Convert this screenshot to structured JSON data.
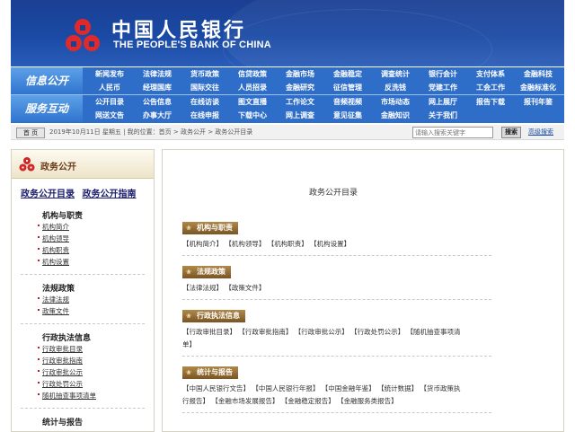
{
  "header": {
    "bank_cn": "中国人民银行",
    "bank_en": "THE PEOPLE'S BANK OF CHINA"
  },
  "nav": {
    "row1": {
      "label": "信息公开",
      "items": [
        "新闻发布",
        "法律法规",
        "货币政策",
        "信贷政策",
        "金融市场",
        "金融稳定",
        "调查统计",
        "银行会计",
        "支付体系",
        "金融科技",
        "人民币",
        "经理国库",
        "国际交往",
        "人员招录",
        "金融研究",
        "征信管理",
        "反洗钱",
        "党建工作",
        "工会工作",
        "金融标准化"
      ]
    },
    "row2": {
      "label": "服务互动",
      "items": [
        "公开目录",
        "公告信息",
        "在线访谈",
        "图文直播",
        "工作论文",
        "音频视频",
        "市场动态",
        "网上展厅",
        "报告下载",
        "报刊年鉴",
        "网送文告",
        "办事大厅",
        "在线申报",
        "下载中心",
        "网上调查",
        "意见征集",
        "金融知识",
        "关于我们"
      ]
    }
  },
  "crumb": {
    "home_label": "首 页",
    "text": "2019年10月11日  星期五  | 我的位置：首页 > 政务公开 > 政务公开目录",
    "search_placeholder": "请输入搜索关键字",
    "search_label": "搜索",
    "advanced_label": "高级搜索"
  },
  "sidebar": {
    "title": "政务公开",
    "link1": "政务公开目录",
    "link2": "政务公开指南",
    "sections": [
      {
        "title": "机构与职责",
        "items": [
          "机构简介",
          "机构领导",
          "机构职责",
          "机构设置"
        ]
      },
      {
        "title": "法规政策",
        "items": [
          "法律法规",
          "政策文件"
        ]
      },
      {
        "title": "行政执法信息",
        "items": [
          "行政审批目录",
          "行政审批指南",
          "行政审批公示",
          "行政处罚公示",
          "随机抽查事项清单"
        ]
      },
      {
        "title": "统计与报告",
        "items": []
      }
    ]
  },
  "main": {
    "title": "政务公开目录",
    "categories": [
      {
        "head": "机构与职责",
        "lines": [
          "【机构简介】 【机构领导】 【机构职责】 【机构设置】"
        ]
      },
      {
        "head": "法规政策",
        "lines": [
          "【法律法规】 【政策文件】"
        ]
      },
      {
        "head": "行政执法信息",
        "lines": [
          "【行政审批目录】 【行政审批指南】 【行政审批公示】 【行政处罚公示】 【随机抽查事项清",
          "单】"
        ]
      },
      {
        "head": "统计与报告",
        "lines": [
          "【中国人民银行文告】 【中国人民银行年报】 【中国金融年鉴】 【统计数据】 【货币政策执",
          "行报告】 【金融市场发展报告】 【金融稳定报告】 【金融服务类报告】"
        ]
      }
    ]
  }
}
